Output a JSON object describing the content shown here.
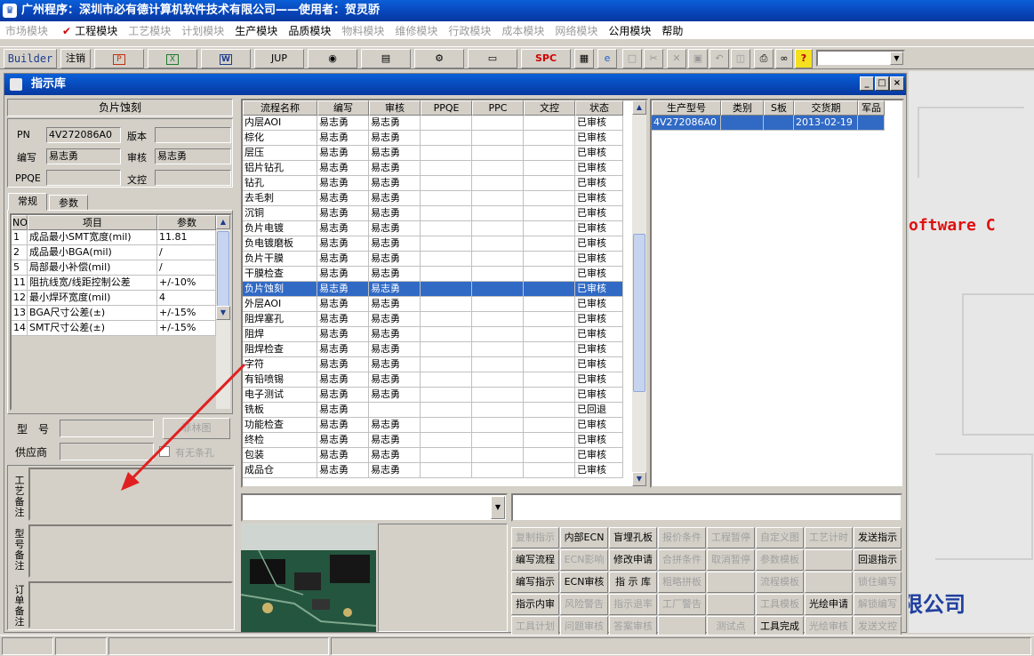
{
  "app_title": "广州程序：深圳市必有德计算机软件技术有限公司——使用者：贺灵骄",
  "menu": [
    {
      "label": "市场模块",
      "on": false
    },
    {
      "label": "工程模块",
      "on": true,
      "checked": true
    },
    {
      "label": "工艺模块",
      "on": false
    },
    {
      "label": "计划模块",
      "on": false
    },
    {
      "label": "生产模块",
      "on": true
    },
    {
      "label": "品质模块",
      "on": true
    },
    {
      "label": "物料模块",
      "on": false
    },
    {
      "label": "维修模块",
      "on": false
    },
    {
      "label": "行政模块",
      "on": false
    },
    {
      "label": "成本模块",
      "on": false
    },
    {
      "label": "网络模块",
      "on": false
    },
    {
      "label": "公用模块",
      "on": true
    },
    {
      "label": "帮助",
      "on": true
    }
  ],
  "toolbar": {
    "builder": "Builder",
    "logout": "注销",
    "jup": "JUP",
    "spc": "SPC",
    "ppt_icon": "ppt-icon",
    "excel_icon": "excel-icon",
    "word_icon": "word-icon"
  },
  "background": {
    "software_text": "oftware C",
    "company_text": "限公司"
  },
  "window": {
    "title": "指示库",
    "minimize": "_",
    "maximize": "□",
    "close": "×"
  },
  "left": {
    "process_name": "负片蚀刻",
    "pn_label": "PN",
    "pn_value": "4V272086A0",
    "version_label": "版本",
    "version_value": "",
    "author_label": "编写",
    "author_value": "易志勇",
    "review_label": "审核",
    "review_value": "易志勇",
    "ppqe_label": "PPQE",
    "ppqe_value": "",
    "doc_label": "文控",
    "doc_value": "",
    "tabs": [
      "常规",
      "参数"
    ],
    "param_headers": [
      "NO",
      "项目",
      "参数"
    ],
    "params": [
      [
        "1",
        "成品最小SMT宽度(mil)",
        "11.81"
      ],
      [
        "2",
        "成品最小BGA(mil)",
        "/"
      ],
      [
        "5",
        "局部最小补偿(mil)",
        "/"
      ],
      [
        "11",
        "阻抗线宽/线距控制公差",
        "+/-10%"
      ],
      [
        "12",
        "最小焊环宽度(mil)",
        "4"
      ],
      [
        "13",
        "BGA尺寸公差(±)",
        "+/-15%"
      ],
      [
        "14",
        "SMT尺寸公差(±)",
        "+/-15%"
      ]
    ],
    "model_label": "型　号",
    "model_value": "",
    "diagram_btn": "菲林图",
    "supplier_label": "供应商",
    "supplier_value": "",
    "barcode_label": "有无条孔",
    "memo_labels": [
      "工艺备注",
      "型号备注",
      "订单备注"
    ]
  },
  "process_table": {
    "headers": [
      "流程名称",
      "编写",
      "审核",
      "PPQE",
      "PPC",
      "文控",
      "状态"
    ],
    "rows": [
      [
        "内层AOI",
        "易志勇",
        "易志勇",
        "",
        "",
        "",
        "已审核"
      ],
      [
        "棕化",
        "易志勇",
        "易志勇",
        "",
        "",
        "",
        "已审核"
      ],
      [
        "层压",
        "易志勇",
        "易志勇",
        "",
        "",
        "",
        "已审核"
      ],
      [
        "铝片钻孔",
        "易志勇",
        "易志勇",
        "",
        "",
        "",
        "已审核"
      ],
      [
        "钻孔",
        "易志勇",
        "易志勇",
        "",
        "",
        "",
        "已审核"
      ],
      [
        "去毛刺",
        "易志勇",
        "易志勇",
        "",
        "",
        "",
        "已审核"
      ],
      [
        "沉铜",
        "易志勇",
        "易志勇",
        "",
        "",
        "",
        "已审核"
      ],
      [
        "负片电镀",
        "易志勇",
        "易志勇",
        "",
        "",
        "",
        "已审核"
      ],
      [
        "负电镀磨板",
        "易志勇",
        "易志勇",
        "",
        "",
        "",
        "已审核"
      ],
      [
        "负片干膜",
        "易志勇",
        "易志勇",
        "",
        "",
        "",
        "已审核"
      ],
      [
        "干膜检查",
        "易志勇",
        "易志勇",
        "",
        "",
        "",
        "已审核"
      ],
      [
        "负片蚀刻",
        "易志勇",
        "易志勇",
        "",
        "",
        "",
        "已审核"
      ],
      [
        "外层AOI",
        "易志勇",
        "易志勇",
        "",
        "",
        "",
        "已审核"
      ],
      [
        "阻焊塞孔",
        "易志勇",
        "易志勇",
        "",
        "",
        "",
        "已审核"
      ],
      [
        "阻焊",
        "易志勇",
        "易志勇",
        "",
        "",
        "",
        "已审核"
      ],
      [
        "阻焊检查",
        "易志勇",
        "易志勇",
        "",
        "",
        "",
        "已审核"
      ],
      [
        "字符",
        "易志勇",
        "易志勇",
        "",
        "",
        "",
        "已审核"
      ],
      [
        "有铅喷锡",
        "易志勇",
        "易志勇",
        "",
        "",
        "",
        "已审核"
      ],
      [
        "电子测试",
        "易志勇",
        "易志勇",
        "",
        "",
        "",
        "已审核"
      ],
      [
        "铣板",
        "易志勇",
        "",
        "",
        "",
        "",
        "已回退"
      ],
      [
        "功能检查",
        "易志勇",
        "易志勇",
        "",
        "",
        "",
        "已审核"
      ],
      [
        "终检",
        "易志勇",
        "易志勇",
        "",
        "",
        "",
        "已审核"
      ],
      [
        "包装",
        "易志勇",
        "易志勇",
        "",
        "",
        "",
        "已审核"
      ],
      [
        "成品仓",
        "易志勇",
        "易志勇",
        "",
        "",
        "",
        "已审核"
      ]
    ],
    "selected_index": 11
  },
  "model_table": {
    "headers": [
      "生产型号",
      "类别",
      "S板",
      "交货期",
      "军品"
    ],
    "rows": [
      [
        "4V272086A0",
        "",
        "",
        "2013-02-19",
        ""
      ]
    ]
  },
  "function_buttons": [
    [
      {
        "label": "复制指示",
        "en": false
      },
      {
        "label": "内部ECN",
        "en": true
      },
      {
        "label": "盲埋孔板",
        "en": true
      },
      {
        "label": "报价条件",
        "en": false
      },
      {
        "label": "工程暂停",
        "en": false
      },
      {
        "label": "自定义图",
        "en": false
      },
      {
        "label": "工艺计时",
        "en": false
      },
      {
        "label": "发送指示",
        "en": true
      }
    ],
    [
      {
        "label": "编写流程",
        "en": true
      },
      {
        "label": "ECN影响",
        "en": false
      },
      {
        "label": "修改申请",
        "en": true
      },
      {
        "label": "合拼条件",
        "en": false
      },
      {
        "label": "取消暂停",
        "en": false
      },
      {
        "label": "参数模板",
        "en": false
      },
      {
        "label": "",
        "en": false
      },
      {
        "label": "回退指示",
        "en": true
      }
    ],
    [
      {
        "label": "编写指示",
        "en": true
      },
      {
        "label": "ECN审核",
        "en": true
      },
      {
        "label": "指 示 库",
        "en": true
      },
      {
        "label": "粗略拼板",
        "en": false
      },
      {
        "label": "",
        "en": false
      },
      {
        "label": "流程模板",
        "en": false
      },
      {
        "label": "",
        "en": false
      },
      {
        "label": "锁住编写",
        "en": false
      }
    ],
    [
      {
        "label": "指示内审",
        "en": true
      },
      {
        "label": "风险警告",
        "en": false
      },
      {
        "label": "指示退率",
        "en": false
      },
      {
        "label": "工厂警告",
        "en": false
      },
      {
        "label": "",
        "en": false
      },
      {
        "label": "工具模板",
        "en": false
      },
      {
        "label": "光绘申请",
        "en": true
      },
      {
        "label": "解锁编写",
        "en": false
      }
    ],
    [
      {
        "label": "工具计划",
        "en": false
      },
      {
        "label": "问题审核",
        "en": false
      },
      {
        "label": "答案审核",
        "en": false
      },
      {
        "label": "",
        "en": false
      },
      {
        "label": "测试点",
        "en": false
      },
      {
        "label": "工具完成",
        "en": true
      },
      {
        "label": "光绘审核",
        "en": false
      },
      {
        "label": "发送文控",
        "en": false
      }
    ]
  ]
}
